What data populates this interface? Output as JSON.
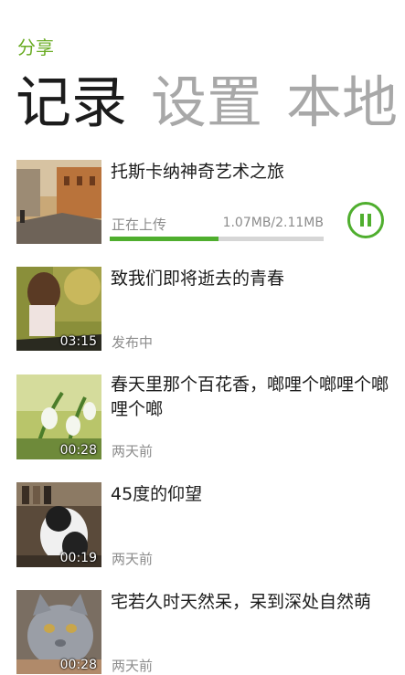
{
  "app": {
    "title": "分享"
  },
  "pivot": {
    "tabs": [
      "记录",
      "设置",
      "本地"
    ],
    "active_index": 0
  },
  "items": [
    {
      "title": "托斯卡纳神奇艺术之旅",
      "status": "正在上传",
      "size": "1.07MB/2.11MB",
      "progress": 0.507,
      "duration": ""
    },
    {
      "title": "致我们即将逝去的青春",
      "status": "发布中",
      "duration": "03:15"
    },
    {
      "title": "春天里那个百花香，啷哩个啷哩个啷哩个啷",
      "status": "两天前",
      "duration": "00:28"
    },
    {
      "title": "45度的仰望",
      "status": "两天前",
      "duration": "00:19"
    },
    {
      "title": "宅若久时天然呆，呆到深处自然萌",
      "status": "两天前",
      "duration": "00:28"
    }
  ],
  "colors": {
    "accent": "#6aac24",
    "progress": "#4fae2e",
    "progress_track": "#d6d6d6"
  },
  "icons": {
    "upload_control": "pause-icon"
  }
}
